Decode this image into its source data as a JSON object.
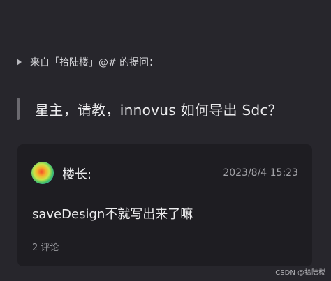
{
  "question_header": {
    "icon": "triangle-right-icon",
    "text": "来自「拾陆楼」@# 的提问："
  },
  "question": {
    "text": "星主，请教，innovus 如何导出 Sdc？"
  },
  "answer": {
    "author": "楼长:",
    "time": "2023/8/4 15:23",
    "content": "saveDesign不就写出来了嘛",
    "comments": "2 评论"
  },
  "watermark": "CSDN @拾陆楼",
  "colors": {
    "background": "#27262c",
    "card": "#1e1d22",
    "text": "#e8e8ea",
    "muted": "#a3a3a8"
  }
}
